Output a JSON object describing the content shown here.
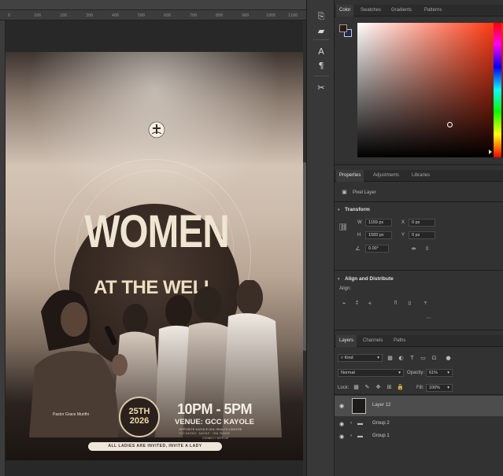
{
  "ruler": {
    "ticks": [
      "0",
      "100",
      "200",
      "300",
      "400",
      "500",
      "600",
      "700",
      "800",
      "900",
      "1000",
      "1100"
    ]
  },
  "poster": {
    "title_main": "WOMEN",
    "title_sub": "AT THE WELL",
    "date_day": "25TH",
    "date_year": "2026",
    "time": "10PM - 5PM",
    "venue": "VENUE: GCC KAYOLE",
    "venue_detail": "OPPOSITE KAYOLE DHL HEALTH CENTRE",
    "venue_detail2": "GCC KAYOLE · KAYOLE · +254 7000000",
    "venue_detail3": "CONNECT WITH US",
    "pastor": "Pastor Grace Murithi",
    "invite": "ALL LADIES ARE INVITED, INVITE A LADY"
  },
  "color_panel": {
    "tabs": [
      "Color",
      "Swatches",
      "Gradients",
      "Patterns"
    ],
    "active_tab": "Color",
    "fg_color": "#2f1b16",
    "bg_color": "#1d2a5c"
  },
  "properties_panel": {
    "tabs": [
      "Properties",
      "Adjustments",
      "Libraries"
    ],
    "layer_kind": "Pixel Layer",
    "transform": {
      "label": "Transform",
      "w_label": "W",
      "w_value": "1159 px",
      "h_label": "H",
      "h_value": "1583 px",
      "x_label": "X",
      "x_value": "0 px",
      "y_label": "Y",
      "y_value": "0 px",
      "angle_value": "0.00°"
    },
    "align": {
      "label": "Align and Distribute",
      "sub": "Align:"
    }
  },
  "layers_panel": {
    "tabs": [
      "Layers",
      "Channels",
      "Paths"
    ],
    "filter_kind": "Kind",
    "blend_mode": "Normal",
    "opacity_label": "Opacity:",
    "opacity_value": "61%",
    "lock_label": "Lock:",
    "fill_label": "Fill:",
    "fill_value": "100%",
    "layers": [
      {
        "name": "Layer 12",
        "selected": true
      },
      {
        "name": "Group 2",
        "selected": false
      },
      {
        "name": "Group 1",
        "selected": false
      }
    ]
  }
}
